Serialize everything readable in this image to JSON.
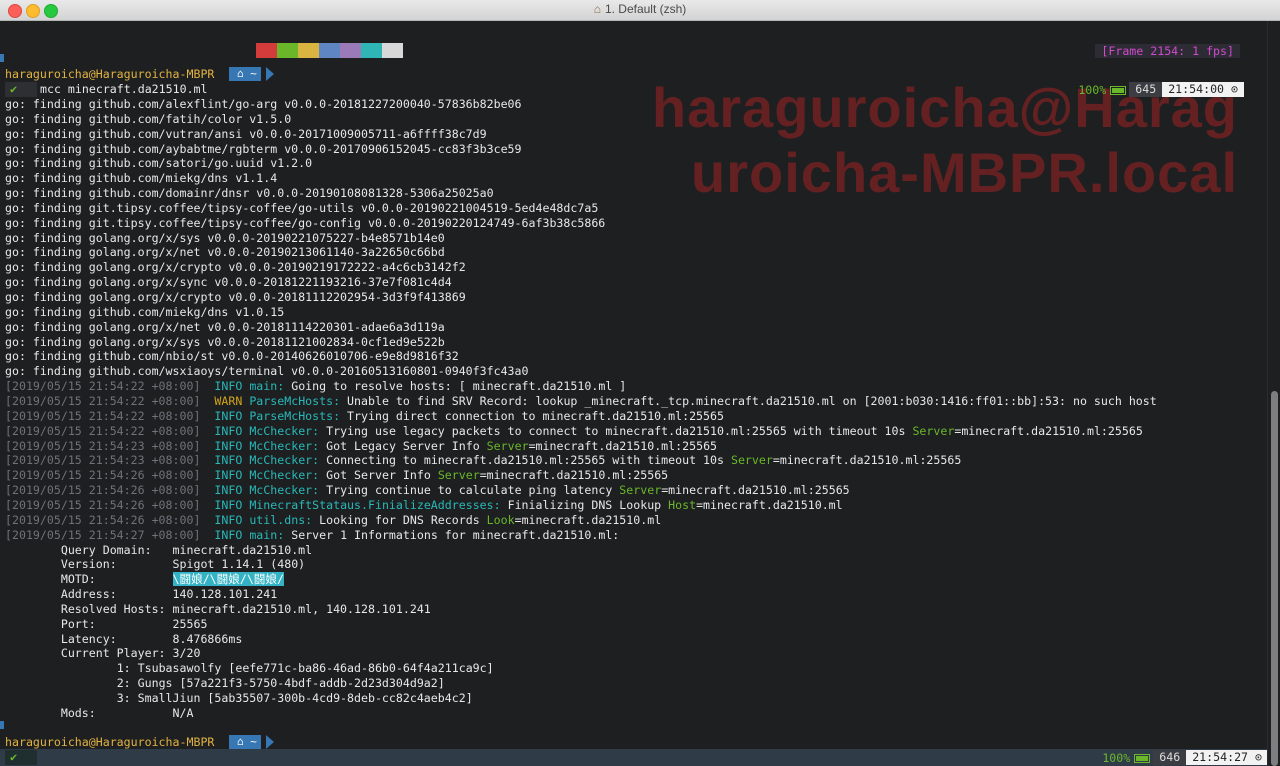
{
  "window": {
    "title": "1. Default (zsh)"
  },
  "frame_info": "[Frame 2154: 1 fps]",
  "watermark": {
    "line1": "haraguroicha@Harag",
    "line2": "uroicha-MBPR.local"
  },
  "palette_colors": [
    "#d43c3c",
    "#6ab82a",
    "#d9b440",
    "#5f86c2",
    "#9a7ab8",
    "#2fb5b5",
    "#d8d8d8"
  ],
  "prompt": {
    "user_host": "haraguroicha@Haraguroicha-MBPR",
    "dir_icon": "home-icon",
    "dir": "~",
    "check": "✔",
    "command": "mcc minecraft.da21510.ml"
  },
  "status_top": {
    "apple": "",
    "battery": "100%",
    "history": "645",
    "time": "21:54:00"
  },
  "status_bottom": {
    "apple": "",
    "battery": "100%",
    "history": "646",
    "time": "21:54:27"
  },
  "go_lines": [
    "go: finding github.com/alexflint/go-arg v0.0.0-20181227200040-57836b82be06",
    "go: finding github.com/fatih/color v1.5.0",
    "go: finding github.com/vutran/ansi v0.0.0-20171009005711-a6ffff38c7d9",
    "go: finding github.com/aybabtme/rgbterm v0.0.0-20170906152045-cc83f3b3ce59",
    "go: finding github.com/satori/go.uuid v1.2.0",
    "go: finding github.com/miekg/dns v1.1.4",
    "go: finding github.com/domainr/dnsr v0.0.0-20190108081328-5306a25025a0",
    "go: finding git.tipsy.coffee/tipsy-coffee/go-utils v0.0.0-20190221004519-5ed4e48dc7a5",
    "go: finding git.tipsy.coffee/tipsy-coffee/go-config v0.0.0-20190220124749-6af3b38c5866",
    "go: finding golang.org/x/sys v0.0.0-20190221075227-b4e8571b14e0",
    "go: finding golang.org/x/net v0.0.0-20190213061140-3a22650c66bd",
    "go: finding golang.org/x/crypto v0.0.0-20190219172222-a4c6cb3142f2",
    "go: finding golang.org/x/sync v0.0.0-20181221193216-37e7f081c4d4",
    "go: finding golang.org/x/crypto v0.0.0-20181112202954-3d3f9f413869",
    "go: finding github.com/miekg/dns v1.0.15",
    "go: finding golang.org/x/net v0.0.0-20181114220301-adae6a3d119a",
    "go: finding golang.org/x/sys v0.0.0-20181121002834-0cf1ed9e522b",
    "go: finding github.com/nbio/st v0.0.0-20140626010706-e9e8d9816f32",
    "go: finding github.com/wsxiaoys/terminal v0.0.0-20160513160801-0940f3fc43a0"
  ],
  "log_lines": [
    {
      "ts": "[2019/05/15 21:54:22 +08:00]",
      "level": "INFO",
      "module": "main:",
      "msg": " Going to resolve hosts: [ minecraft.da21510.ml ]",
      "key": "",
      "val": ""
    },
    {
      "ts": "[2019/05/15 21:54:22 +08:00]",
      "level": "WARN",
      "module": "ParseMcHosts:",
      "msg": " Unable to find SRV Record: lookup _minecraft._tcp.minecraft.da21510.ml on [2001:b030:1416:ff01::bb]:53: no such host",
      "key": "",
      "val": ""
    },
    {
      "ts": "[2019/05/15 21:54:22 +08:00]",
      "level": "INFO",
      "module": "ParseMcHosts:",
      "msg": " Trying direct connection to minecraft.da21510.ml:25565",
      "key": "",
      "val": ""
    },
    {
      "ts": "[2019/05/15 21:54:22 +08:00]",
      "level": "INFO",
      "module": "McChecker:",
      "msg": " Trying use legacy packets to connect to minecraft.da21510.ml:25565 with timeout 10s ",
      "key": "Server",
      "val": "=minecraft.da21510.ml:25565"
    },
    {
      "ts": "[2019/05/15 21:54:23 +08:00]",
      "level": "INFO",
      "module": "McChecker:",
      "msg": " Got Legacy Server Info ",
      "key": "Server",
      "val": "=minecraft.da21510.ml:25565"
    },
    {
      "ts": "[2019/05/15 21:54:23 +08:00]",
      "level": "INFO",
      "module": "McChecker:",
      "msg": " Connecting to minecraft.da21510.ml:25565 with timeout 10s ",
      "key": "Server",
      "val": "=minecraft.da21510.ml:25565"
    },
    {
      "ts": "[2019/05/15 21:54:26 +08:00]",
      "level": "INFO",
      "module": "McChecker:",
      "msg": " Got Server Info ",
      "key": "Server",
      "val": "=minecraft.da21510.ml:25565"
    },
    {
      "ts": "[2019/05/15 21:54:26 +08:00]",
      "level": "INFO",
      "module": "McChecker:",
      "msg": " Trying continue to calculate ping latency ",
      "key": "Server",
      "val": "=minecraft.da21510.ml:25565"
    },
    {
      "ts": "[2019/05/15 21:54:26 +08:00]",
      "level": "INFO",
      "module": "MinecraftStataus.FinializeAddresses:",
      "msg": " Finializing DNS Lookup ",
      "key": "Host",
      "val": "=minecraft.da21510.ml"
    },
    {
      "ts": "[2019/05/15 21:54:26 +08:00]",
      "level": "INFO",
      "module": "util.dns:",
      "msg": " Looking for DNS Records ",
      "key": "Look",
      "val": "=minecraft.da21510.ml"
    },
    {
      "ts": "[2019/05/15 21:54:27 +08:00]",
      "level": "INFO",
      "module": "main:",
      "msg": " Server 1 Informations for minecraft.da21510.ml:",
      "key": "",
      "val": ""
    }
  ],
  "server_info": [
    {
      "label": "        Query Domain:   ",
      "value": "minecraft.da21510.ml",
      "highlight": false
    },
    {
      "label": "        Version:        ",
      "value": "Spigot 1.14.1 (480)",
      "highlight": false
    },
    {
      "label": "        MOTD:           ",
      "value": "\\闘娘/\\闘娘/\\闘娘/",
      "highlight": true
    },
    {
      "label": "        Address:        ",
      "value": "140.128.101.241",
      "highlight": false
    },
    {
      "label": "        Resolved Hosts: ",
      "value": "minecraft.da21510.ml, 140.128.101.241",
      "highlight": false
    },
    {
      "label": "        Port:           ",
      "value": "25565",
      "highlight": false
    },
    {
      "label": "        Latency:        ",
      "value": "8.476866ms",
      "highlight": false
    },
    {
      "label": "        Current Player: ",
      "value": "3/20",
      "highlight": false
    },
    {
      "label": "                ",
      "value": "1: Tsubasawolfy [eefe771c-ba86-46ad-86b0-64f4a211ca9c]",
      "highlight": false
    },
    {
      "label": "                ",
      "value": "2: Gungs [57a221f3-5750-4bdf-addb-2d23d304d9a2]",
      "highlight": false
    },
    {
      "label": "                ",
      "value": "3: SmallJiun [5ab35507-300b-4cd9-8deb-cc82c4aeb4c2]",
      "highlight": false
    },
    {
      "label": "        Mods:           ",
      "value": "N/A",
      "highlight": false
    }
  ]
}
